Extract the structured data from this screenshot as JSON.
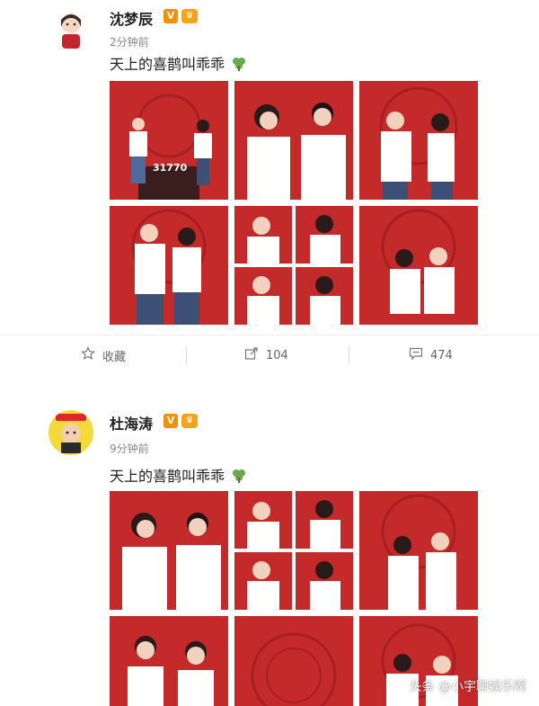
{
  "posts": [
    {
      "username": "沈梦辰",
      "time": "2分钟前",
      "text": "天上的喜鹊叫乖乖",
      "photo_caption": "31770"
    },
    {
      "username": "杜海涛",
      "time": "9分钟前",
      "text": "天上的喜鹊叫乖乖"
    }
  ],
  "actions": {
    "favorite": "收藏",
    "repost_count": "104",
    "comment_count": "474"
  },
  "watermark": "头条 @小宇聊娱乐啊",
  "colors": {
    "photo_red": "#c42a2a",
    "badge_orange": "#f29100"
  },
  "icons": [
    "star-icon",
    "share-icon",
    "comment-icon",
    "verified-icon",
    "level-icon",
    "clover-emoji-icon"
  ]
}
